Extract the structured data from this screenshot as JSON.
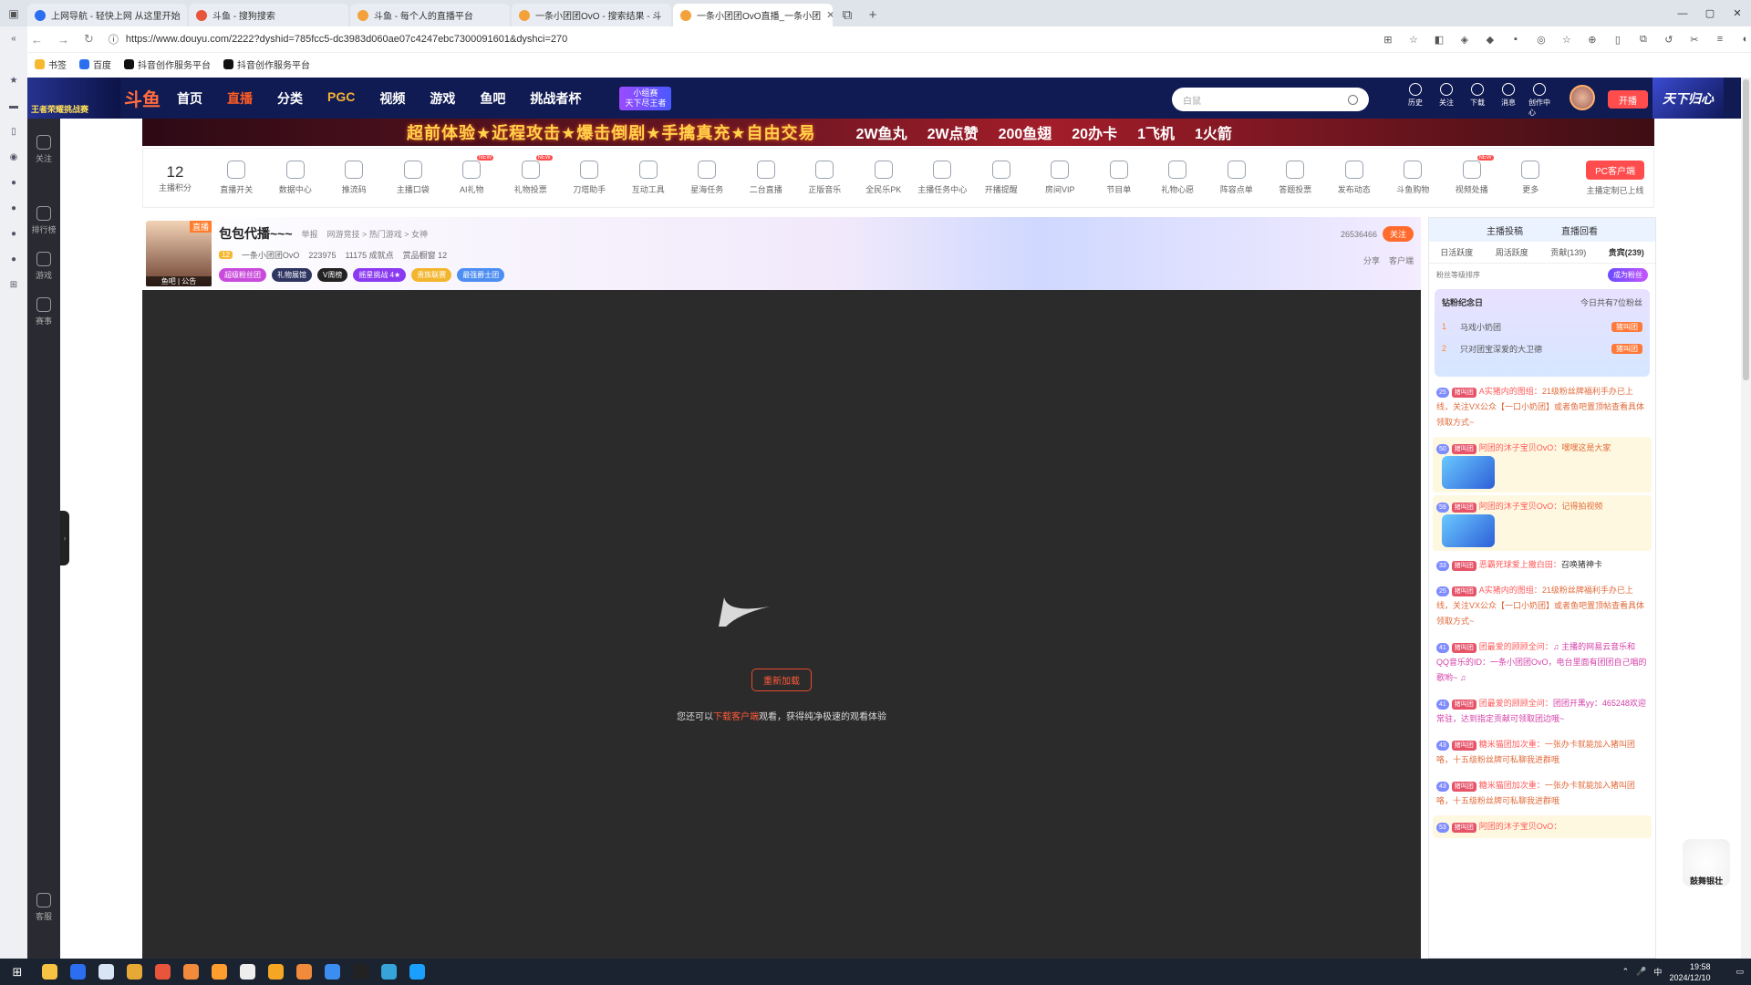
{
  "browser": {
    "tabs": [
      {
        "title": "上网导航 - 轻快上网 从这里开始",
        "color": "#2b6ff0"
      },
      {
        "title": "斗鱼 - 搜狗搜索",
        "color": "#e8553a"
      },
      {
        "title": "斗鱼 - 每个人的直播平台",
        "color": "#f3a23b"
      },
      {
        "title": "一条小团团OvO - 搜索结果 - 斗",
        "color": "#f3a23b"
      },
      {
        "title": "一条小团团OvO直播_一条小团",
        "color": "#f3a23b"
      }
    ],
    "url": "https://www.douyu.com/2222?dyshid=785fcc5-dc3983d060ae07c4247ebc7300091601&dyshci=270",
    "bookmarks": [
      "书签",
      "百度",
      "抖音创作服务平台",
      "抖音创作服务平台"
    ]
  },
  "douyu": {
    "brand": "斗鱼",
    "header_logo_text": "王者荣耀挑战赛",
    "nav": [
      "首页",
      "直播",
      "分类",
      "PGC",
      "视频",
      "游戏",
      "鱼吧",
      "挑战者杯"
    ],
    "badge": "小组赛\n天下尽王者",
    "search_placeholder": "白鼠",
    "header_icons": [
      "历史",
      "关注",
      "下载",
      "消息",
      "创作中心"
    ],
    "kaibo": "开播",
    "header_game": "天下归心",
    "left_menu": [
      "关注",
      "排行榜",
      "游戏",
      "赛事",
      "客服"
    ],
    "banner_title": "超前体验★近程攻击★爆击倒剧★手擒真充★自由交易",
    "banner_prizes": [
      "2W鱼丸",
      "2W点赞",
      "200鱼翅",
      "20办卡",
      "1飞机",
      "1火箭"
    ],
    "score_label": "主播积分",
    "score_value": "12",
    "tools": [
      {
        "label": "直播开关",
        "new": false
      },
      {
        "label": "数据中心",
        "new": false
      },
      {
        "label": "推流码",
        "new": false
      },
      {
        "label": "主播口袋",
        "new": false
      },
      {
        "label": "AI礼物",
        "new": true
      },
      {
        "label": "礼物投票",
        "new": true
      },
      {
        "label": "刀塔助手",
        "new": false
      },
      {
        "label": "互动工具",
        "new": false
      },
      {
        "label": "星海任务",
        "new": false
      },
      {
        "label": "二台直播",
        "new": false
      },
      {
        "label": "正版音乐",
        "new": false
      },
      {
        "label": "全民乐PK",
        "new": false
      },
      {
        "label": "主播任务中心",
        "new": false
      },
      {
        "label": "开播提醒",
        "new": false
      },
      {
        "label": "房间VIP",
        "new": false
      },
      {
        "label": "节目单",
        "new": false
      },
      {
        "label": "礼物心愿",
        "new": false
      },
      {
        "label": "阵容点单",
        "new": false
      },
      {
        "label": "答题投票",
        "new": false
      },
      {
        "label": "发布动态",
        "new": false
      },
      {
        "label": "斗鱼购物",
        "new": false
      },
      {
        "label": "视频处播",
        "new": true
      },
      {
        "label": "更多",
        "new": false
      }
    ],
    "pc_client": "PC客户端",
    "pc_client_sub": "主播定制已上线",
    "room": {
      "avatar_badge": "直播",
      "avatar_caption": "鱼吧 | 公告",
      "name": "包包代播~~~",
      "report": "举报",
      "category": "网游竞技 > 热门游戏 > 女神",
      "level": "12",
      "anchor": "一条小团团OvO",
      "heat": "223975",
      "achievement": "11175 成就点",
      "gift_count": "赏品橱窗 12",
      "tags": [
        "超级粉丝团",
        "礼物展馆",
        "V周榜",
        "摇星挑战 4★",
        "贵族联赛",
        "最强爵士团"
      ],
      "followers": "26536466",
      "follow_btn": "关注",
      "share": "分享",
      "client": "客户端"
    },
    "player": {
      "reload": "重新加载",
      "tip_prefix": "您还可以",
      "tip_link": "下载客户端",
      "tip_suffix": "观看，获得纯净极速的观看体验"
    },
    "side": {
      "top_tabs": [
        "主播投稿",
        "直播回看"
      ],
      "tabs": [
        "日活跃度",
        "周活跃度",
        "贡献(139)",
        "贵宾(239)"
      ],
      "fan_rank_label": "粉丝等级排序",
      "become_fan": "成为粉丝",
      "fan_day_title": "钻粉纪念日",
      "fan_day_note": "今日共有7位粉丝",
      "fan_rows": [
        {
          "rank": "1",
          "name": "马戏小奶团",
          "tag": "猪叫团"
        },
        {
          "rank": "2",
          "name": "只对团宝深爱的大卫德",
          "tag": "猪叫团"
        }
      ],
      "messages": [
        {
          "lv": "25",
          "nick": "A实猪内的图组：",
          "text": "21级粉丝牌福利手办已上线，关注VX公众【一口小奶团】或者鱼吧置顶帖查看具体领取方式~",
          "style": ""
        },
        {
          "lv": "50",
          "nick": "阿团的沐子宝贝OvO：",
          "text": "嘿嘿这是大家",
          "style": "y"
        },
        {
          "lv": "59",
          "nick": "阿团的沐子宝贝OvO：",
          "text": "记得拍视频",
          "style": "y"
        },
        {
          "lv": "33",
          "nick": "恶霸死球爱上撒白田：",
          "text": "召唤猪神卡",
          "style": "k"
        },
        {
          "lv": "25",
          "nick": "A实猪内的图组：",
          "text": "21级粉丝牌福利手办已上线，关注VX公众【一口小奶团】或者鱼吧置顶帖查看具体领取方式~",
          "style": ""
        },
        {
          "lv": "41",
          "nick": "团最爱的顾顾全问：",
          "text": "♫ 主播的网易云音乐和QQ音乐的ID：一条小团团OvO，电台里面有团团自己唱的歌哟~ ♫",
          "style": "b"
        },
        {
          "lv": "41",
          "nick": "团最爱的顾顾全问：",
          "text": "团团开黑yy：465248欢迎常驻，达到指定贡献可领取团边哦~",
          "style": "b"
        },
        {
          "lv": "43",
          "nick": "糖米猫团加次重：",
          "text": "一张办卡就能加入猪叫团咯，十五级粉丝牌可私聊我进群哦",
          "style": ""
        },
        {
          "lv": "43",
          "nick": "糖米猫团加次重：",
          "text": "一张办卡就能加入猪叫团咯，十五级粉丝牌可私聊我进群哦",
          "style": ""
        },
        {
          "lv": "53",
          "nick": "阿团的沐子宝贝OvO：",
          "text": "",
          "style": "y"
        }
      ]
    },
    "float_label": "鼓舞银壮"
  },
  "taskbar": {
    "time": "19:58",
    "date": "2024/12/10",
    "lang": "中"
  }
}
